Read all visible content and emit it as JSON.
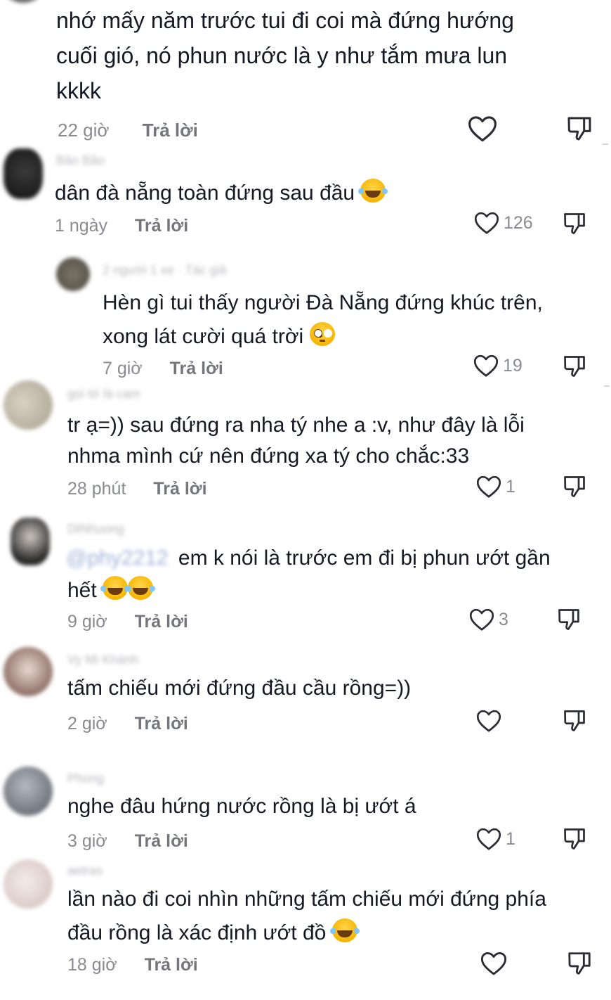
{
  "comments": [
    {
      "lines": [
        "nhớ mấy năm trước tui đi coi mà đứng hướng",
        "cuối gió, nó phun nước là y như tắm mưa lun",
        "kkkk"
      ],
      "time": "22 giờ",
      "reply": "Trả lời",
      "likes": ""
    },
    {
      "username": "Bảo Bảo",
      "text": "dân đà nẵng toàn đứng sau đầu",
      "time": "1 ngày",
      "reply": "Trả lời",
      "likes": "126"
    },
    {
      "username": "2 người 1 xe · Tác giả",
      "lines": [
        "Hèn gì tui thấy người Đà Nẵng đứng khúc trên,",
        "xong lát cười quá trời"
      ],
      "time": "7 giờ",
      "reply": "Trả lời",
      "likes": "19"
    },
    {
      "username": "gọi tớ là cam",
      "lines": [
        "tr ạ=)) sau đứng ra nha tý nhe a :v, như đây là lỗi",
        "nhma mình cứ nên đứng xa tý cho chắc:33"
      ],
      "time": "28 phút",
      "reply": "Trả lời",
      "likes": "1"
    },
    {
      "username": "DtNhuong",
      "mention": "@phy2212",
      "lines": [
        "em k nói là trước em đi bị phun ướt gần",
        "hết"
      ],
      "time": "9 giờ",
      "reply": "Trả lời",
      "likes": "3"
    },
    {
      "username": "Vy Mi Khánh",
      "text": "tấm chiếu mới đứng đầu cầu rồng=))",
      "time": "2 giờ",
      "reply": "Trả lời",
      "likes": ""
    },
    {
      "username": "Phong",
      "text": "nghe đâu hứng nước rồng là bị ướt á",
      "time": "3 giờ",
      "reply": "Trả lời",
      "likes": "1"
    },
    {
      "username": "aetras",
      "lines": [
        "lần nào đi coi nhìn những tấm chiếu mới đứng phía",
        "đầu rồng là xác định ướt đồ"
      ],
      "time": "18 giờ",
      "reply": "Trả lời",
      "likes": ""
    }
  ],
  "icons": {
    "like": "heart-outline-icon",
    "dislike": "thumbs-down-outline-icon",
    "emoji_laugh": "laughing-tears-emoji",
    "emoji_flushed": "flushed-emoji"
  },
  "colors": {
    "text": "#161823",
    "meta": "#8a8b91",
    "reply": "#75767b"
  }
}
